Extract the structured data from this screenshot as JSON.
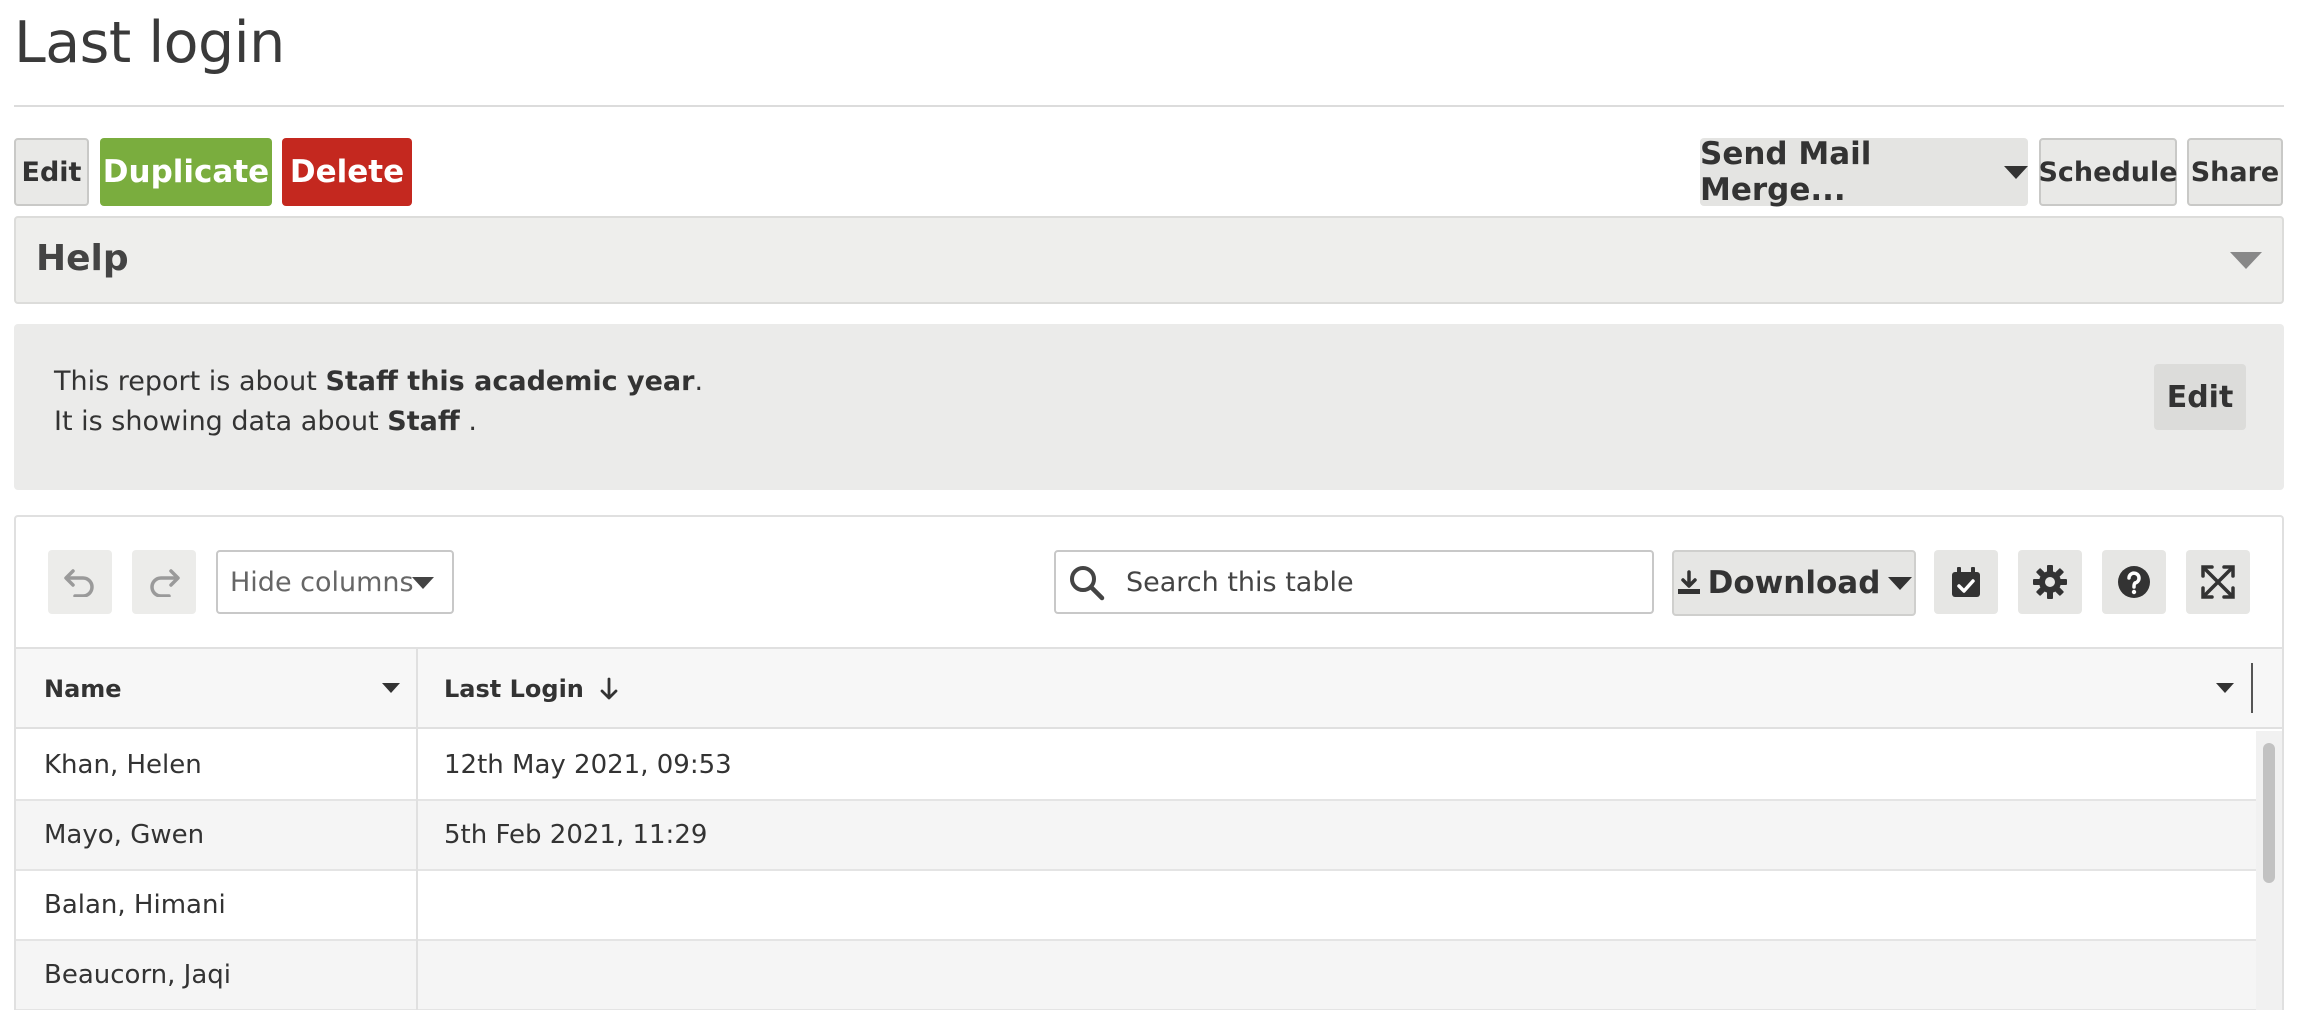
{
  "page": {
    "title": "Last login"
  },
  "actions": {
    "edit": "Edit",
    "duplicate": "Duplicate",
    "delete": "Delete",
    "send_mail_merge": "Send Mail Merge...",
    "schedule": "Schedule",
    "share": "Share"
  },
  "help": {
    "title": "Help"
  },
  "info": {
    "line1_prefix": "This report is about ",
    "line1_bold": "Staff this academic year",
    "line1_suffix": ".",
    "line2_prefix": "It is showing data about ",
    "line2_bold": "Staff",
    "line2_suffix": " .",
    "edit_label": "Edit"
  },
  "toolbar": {
    "hide_columns": "Hide columns",
    "search_placeholder": "Search this table",
    "download": "Download",
    "icons": [
      "undo-icon",
      "redo-icon",
      "search-icon",
      "download-icon",
      "calendar-check-icon",
      "gear-icon",
      "question-icon",
      "expand-icon"
    ]
  },
  "table": {
    "columns": [
      "Name",
      "Last Login"
    ],
    "sort": {
      "column": "Last Login",
      "direction": "descending"
    },
    "rows": [
      {
        "name": "Khan, Helen",
        "last_login": "12th May 2021, 09:53"
      },
      {
        "name": "Mayo, Gwen",
        "last_login": "5th Feb 2021, 11:29"
      },
      {
        "name": "Balan, Himani",
        "last_login": ""
      },
      {
        "name": "Beaucorn, Jaqi",
        "last_login": ""
      }
    ]
  },
  "colors": {
    "duplicate": "#7aad3e",
    "delete": "#c4281f",
    "button_grey": "#e9e9e7",
    "info_background": "#ebebea"
  }
}
